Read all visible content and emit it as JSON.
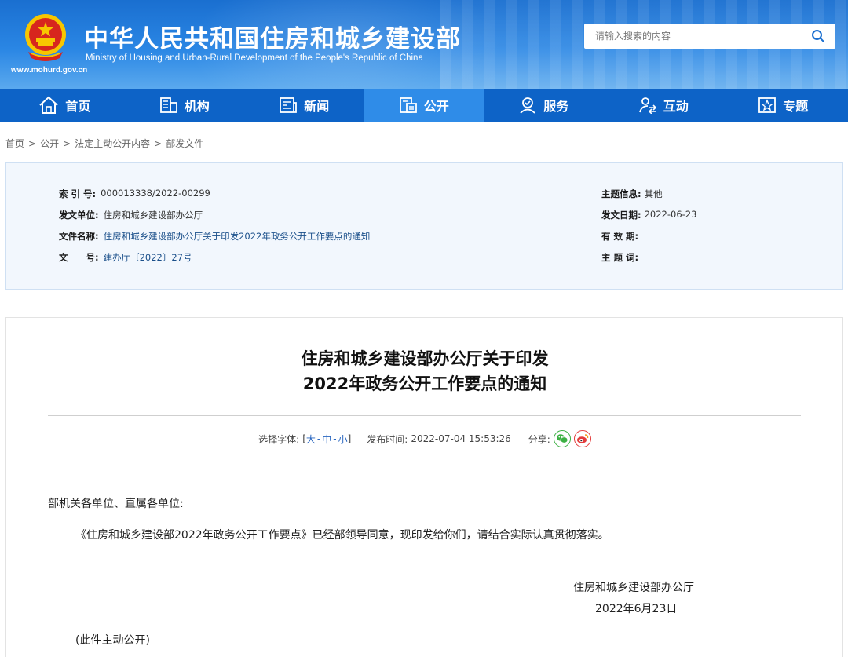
{
  "header": {
    "title_cn": "中华人民共和国住房和城乡建设部",
    "title_en": "Ministry of Housing and Urban-Rural Development of the People's Republic of China",
    "url": "www.mohurd.gov.cn",
    "search_placeholder": "请输入搜索的内容"
  },
  "nav": {
    "items": [
      {
        "label": "首页",
        "icon": "home-icon"
      },
      {
        "label": "机构",
        "icon": "building-icon"
      },
      {
        "label": "新闻",
        "icon": "newspaper-icon"
      },
      {
        "label": "公开",
        "icon": "document-icon"
      },
      {
        "label": "服务",
        "icon": "service-icon"
      },
      {
        "label": "互动",
        "icon": "interact-icon"
      },
      {
        "label": "专题",
        "icon": "star-icon"
      }
    ],
    "active": "公开",
    "active_color": "#2f8ce8",
    "bar_color": "#0d63c7"
  },
  "breadcrumb": [
    "首页",
    "公开",
    "法定主动公开内容",
    "部发文件"
  ],
  "meta": {
    "index_label": "索 引 号:",
    "index_value": "000013338/2022-00299",
    "issuer_label": "发文单位:",
    "issuer_value": "住房和城乡建设部办公厅",
    "docname_label": "文件名称:",
    "docname_value": "住房和城乡建设部办公厅关于印发2022年政务公开工作要点的通知",
    "docno_label": "文　　号:",
    "docno_value": "建办厅〔2022〕27号",
    "topic_label": "主题信息:",
    "topic_value": "其他",
    "date_label": "发文日期:",
    "date_value": "2022-06-23",
    "valid_label": "有 效 期:",
    "valid_value": "",
    "keyword_label": "主 题 词:",
    "keyword_value": ""
  },
  "article": {
    "title_line1": "住房和城乡建设部办公厅关于印发",
    "title_line2": "2022年政务公开工作要点的通知",
    "font_label": "选择字体:",
    "font_open": "[",
    "font_large": "大",
    "font_medium": "中",
    "font_small": "小",
    "font_close": "]",
    "font_dash": "-",
    "publish_label": "发布时间:",
    "publish_time": "2022-07-04 15:53:26",
    "share_label": "分享:",
    "salutation": "部机关各单位、直属各单位:",
    "paragraph": "《住房和城乡建设部2022年政务公开工作要点》已经部领导同意，现印发给你们，请结合实际认真贯彻落实。",
    "signature_org": "住房和城乡建设部办公厅",
    "signature_date": "2022年6月23日",
    "disclosure": "(此件主动公开)"
  }
}
